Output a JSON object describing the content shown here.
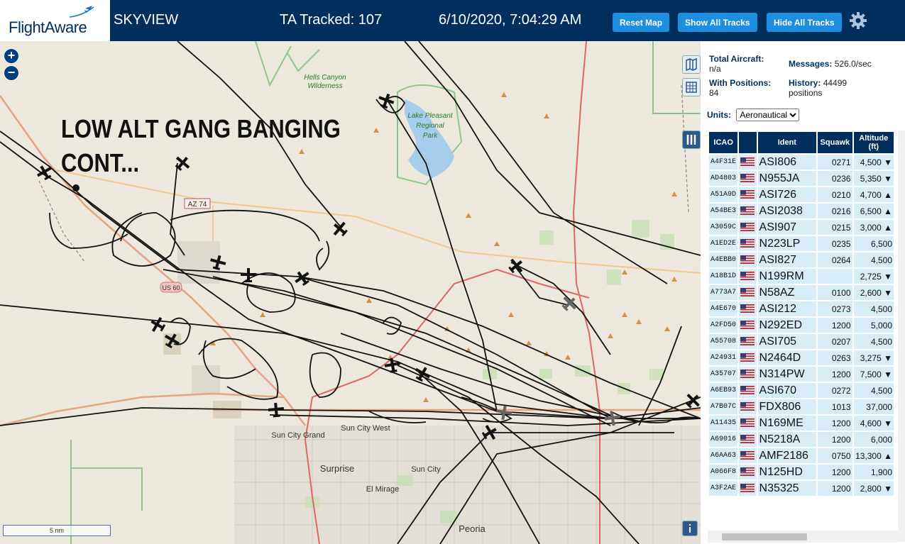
{
  "header": {
    "logo": "FlightAware",
    "app_name": "SKYVIEW",
    "tracked": "TA Tracked: 107",
    "datetime": "6/10/2020, 7:04:29 AM",
    "reset_label": "Reset Map",
    "show_label": "Show All Tracks",
    "hide_label": "Hide All Tracks"
  },
  "map": {
    "overlay_line1": "LOW ALT GANG BANGING",
    "overlay_line2": "CONT...",
    "scale_label": "5 nm",
    "labels": {
      "hells_canyon": "Hells Canyon",
      "wilderness": "Wilderness",
      "lake1": "Lake Pleasant",
      "lake2": "Regional",
      "lake3": "Park",
      "az74": "AZ 74",
      "us60": "US 60",
      "sun_city_grand": "Sun City Grand",
      "sun_city_west": "Sun City West",
      "surprise": "Surprise",
      "sun_city": "Sun City",
      "el_mirage": "El Mirage",
      "peoria": "Peoria"
    }
  },
  "stats": {
    "total_label": "Total Aircraft:",
    "total_value": "n/a",
    "messages_label": "Messages:",
    "messages_value": "526.0/sec",
    "positions_label": "With Positions:",
    "positions_value": "84",
    "history_label": "History:",
    "history_value": "44499 positions"
  },
  "units": {
    "label": "Units:",
    "value": "Aeronautical"
  },
  "table": {
    "columns": [
      "ICAO",
      "",
      "Ident",
      "Squawk",
      "Altitude (ft)"
    ],
    "rows": [
      [
        "A4F31E",
        "ASI806",
        "0271",
        "4,500 ▼"
      ],
      [
        "AD4803",
        "N955JA",
        "0236",
        "5,350 ▼"
      ],
      [
        "A51A9D",
        "ASI726",
        "0210",
        "4,700 ▲"
      ],
      [
        "A54BE3",
        "ASI2038",
        "0216",
        "6,500 ▲"
      ],
      [
        "A3059C",
        "ASI907",
        "0215",
        "3,000 ▲"
      ],
      [
        "A1ED2E",
        "N223LP",
        "0235",
        "6,500"
      ],
      [
        "A4EBB0",
        "ASI827",
        "0264",
        "4,500"
      ],
      [
        "A18B1D",
        "N199RM",
        "",
        "2,725 ▼"
      ],
      [
        "A773A7",
        "N58AZ",
        "0100",
        "2,600 ▼"
      ],
      [
        "A4E670",
        "ASI212",
        "0273",
        "4,500"
      ],
      [
        "A2FD50",
        "N292ED",
        "1200",
        "5,000"
      ],
      [
        "A55708",
        "ASI705",
        "0207",
        "4,500"
      ],
      [
        "A24931",
        "N2464D",
        "0263",
        "3,275 ▼"
      ],
      [
        "A35707",
        "N314PW",
        "1200",
        "7,500 ▼"
      ],
      [
        "A6EB93",
        "ASI670",
        "0272",
        "4,500"
      ],
      [
        "A7B07C",
        "FDX806",
        "1013",
        "37,000"
      ],
      [
        "A11435",
        "N169ME",
        "1200",
        "4,600 ▼"
      ],
      [
        "A69016",
        "N5218A",
        "1200",
        "6,000"
      ],
      [
        "A6AA63",
        "AMF2186",
        "0750",
        "13,300 ▲"
      ],
      [
        "A066F8",
        "N125HD",
        "1200",
        "1,900"
      ],
      [
        "A3F2AE",
        "N35325",
        "1200",
        "2,800 ▼"
      ]
    ]
  }
}
